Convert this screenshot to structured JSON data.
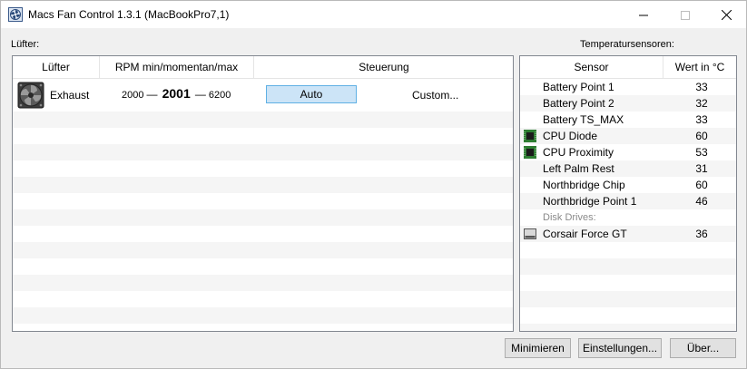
{
  "window": {
    "title": "Macs Fan Control 1.3.1 (MacBookPro7,1)"
  },
  "fans_section": {
    "label": "Lüfter:",
    "columns": [
      "Lüfter",
      "RPM min/momentan/max",
      "Steuerung"
    ],
    "fans": [
      {
        "name": "Exhaust",
        "rpm_min": "2000",
        "rpm_current": "2001",
        "rpm_max": "6200",
        "separator": "—",
        "auto_label": "Auto",
        "custom_label": "Custom..."
      }
    ]
  },
  "sensors_section": {
    "label": "Temperatursensoren:",
    "columns": [
      "Sensor",
      "Wert in °C"
    ],
    "rows": [
      {
        "name": "Battery Point 1",
        "value": "33",
        "icon": "none"
      },
      {
        "name": "Battery Point 2",
        "value": "32",
        "icon": "none"
      },
      {
        "name": "Battery TS_MAX",
        "value": "33",
        "icon": "none"
      },
      {
        "name": "CPU Diode",
        "value": "60",
        "icon": "chip-icon"
      },
      {
        "name": "CPU Proximity",
        "value": "53",
        "icon": "chip-icon"
      },
      {
        "name": "Left Palm Rest",
        "value": "31",
        "icon": "none"
      },
      {
        "name": "Northbridge Chip",
        "value": "60",
        "icon": "none"
      },
      {
        "name": "Northbridge Point 1",
        "value": "46",
        "icon": "none"
      },
      {
        "name": "Disk Drives:",
        "value": "",
        "icon": "none",
        "group": true
      },
      {
        "name": "Corsair Force GT",
        "value": "36",
        "icon": "disk-icon"
      }
    ]
  },
  "buttons": {
    "minimize": "Minimieren",
    "settings": "Einstellungen...",
    "about": "Über..."
  },
  "colors": {
    "auto_button_bg": "#cce4f7",
    "auto_button_border": "#5fb0e4",
    "chip_green": "#4caf50",
    "group_text": "#8a8a8a"
  }
}
